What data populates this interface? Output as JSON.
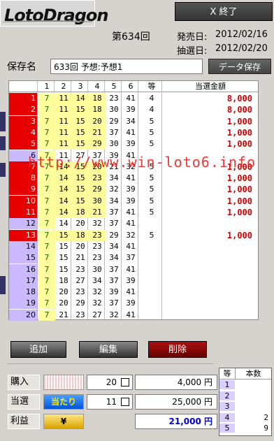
{
  "app": {
    "name": "LotoDragon",
    "logo_part1": "Loto",
    "logo_part2": "Dragon"
  },
  "header": {
    "exit_label": "X 終了",
    "draw_number": "第634回",
    "sale_label": "発売日:",
    "sale_date": "2012/02/16",
    "lottery_label": "抽選日:",
    "lottery_date": "2012/02/20"
  },
  "save": {
    "label": "保存名",
    "value": "633回 予想:予想1",
    "button": "データ保存"
  },
  "grid": {
    "headers": [
      "1",
      "2",
      "3",
      "4",
      "5",
      "6",
      "等",
      "当選金額"
    ],
    "rows": [
      {
        "n": "1",
        "nums": [
          "7",
          "11",
          "14",
          "18",
          "23",
          "41"
        ],
        "grade": "4",
        "prize": "8,000",
        "color": "red"
      },
      {
        "n": "2",
        "nums": [
          "7",
          "11",
          "15",
          "18",
          "30",
          "39"
        ],
        "grade": "4",
        "prize": "8,000",
        "color": "red"
      },
      {
        "n": "3",
        "nums": [
          "7",
          "11",
          "15",
          "20",
          "29",
          "34"
        ],
        "grade": "5",
        "prize": "1,000",
        "color": "red"
      },
      {
        "n": "4",
        "nums": [
          "7",
          "11",
          "15",
          "21",
          "37",
          "41"
        ],
        "grade": "5",
        "prize": "1,000",
        "color": "red"
      },
      {
        "n": "5",
        "nums": [
          "7",
          "11",
          "15",
          "29",
          "30",
          "39"
        ],
        "grade": "5",
        "prize": "1,000",
        "color": "red"
      },
      {
        "n": "6",
        "nums": [
          "7",
          "11",
          "27",
          "37",
          "39",
          "41"
        ],
        "grade": "",
        "prize": "",
        "color": "lav"
      },
      {
        "n": "7",
        "nums": [
          "7",
          "14",
          "15",
          "20",
          "21",
          "32"
        ],
        "grade": "5",
        "prize": "1,000",
        "color": "red"
      },
      {
        "n": "8",
        "nums": [
          "7",
          "14",
          "15",
          "23",
          "34",
          "41"
        ],
        "grade": "5",
        "prize": "1,000",
        "color": "red"
      },
      {
        "n": "9",
        "nums": [
          "7",
          "14",
          "15",
          "29",
          "32",
          "39"
        ],
        "grade": "5",
        "prize": "1,000",
        "color": "red"
      },
      {
        "n": "10",
        "nums": [
          "7",
          "14",
          "15",
          "30",
          "34",
          "39"
        ],
        "grade": "5",
        "prize": "1,000",
        "color": "red"
      },
      {
        "n": "11",
        "nums": [
          "7",
          "14",
          "18",
          "21",
          "37",
          "41"
        ],
        "grade": "5",
        "prize": "1,000",
        "color": "red"
      },
      {
        "n": "12",
        "nums": [
          "7",
          "14",
          "20",
          "32",
          "37",
          "41"
        ],
        "grade": "",
        "prize": "",
        "color": "lav"
      },
      {
        "n": "13",
        "nums": [
          "7",
          "15",
          "18",
          "23",
          "29",
          "32"
        ],
        "grade": "5",
        "prize": "1,000",
        "color": "red"
      },
      {
        "n": "14",
        "nums": [
          "7",
          "15",
          "20",
          "23",
          "34",
          "41"
        ],
        "grade": "",
        "prize": "",
        "color": "lav"
      },
      {
        "n": "15",
        "nums": [
          "7",
          "15",
          "21",
          "23",
          "34",
          "37"
        ],
        "grade": "",
        "prize": "",
        "color": "lav"
      },
      {
        "n": "16",
        "nums": [
          "7",
          "15",
          "23",
          "30",
          "37",
          "41"
        ],
        "grade": "",
        "prize": "",
        "color": "lav"
      },
      {
        "n": "17",
        "nums": [
          "7",
          "18",
          "27",
          "34",
          "37",
          "39"
        ],
        "grade": "",
        "prize": "",
        "color": "lav"
      },
      {
        "n": "18",
        "nums": [
          "7",
          "20",
          "23",
          "32",
          "39",
          "41"
        ],
        "grade": "",
        "prize": "",
        "color": "lav"
      },
      {
        "n": "19",
        "nums": [
          "7",
          "20",
          "29",
          "32",
          "37",
          "39"
        ],
        "grade": "",
        "prize": "",
        "color": "lav"
      },
      {
        "n": "20",
        "nums": [
          "7",
          "21",
          "23",
          "27",
          "32",
          "41"
        ],
        "grade": "",
        "prize": "",
        "color": "lav"
      }
    ]
  },
  "watermark": "http://www.win-loto6.info",
  "buttons": {
    "add": "追加",
    "edit": "編集",
    "delete": "削除"
  },
  "summary": {
    "purchase_label": "購入",
    "purchase_count": "20",
    "purchase_amount": "4,000 円",
    "win_label": "当選",
    "win_badge": "当たり",
    "win_count": "11",
    "win_amount": "25,000 円",
    "profit_label": "利益",
    "profit_badge": "¥",
    "profit_amount": "21,000 円"
  },
  "grade_table": {
    "header_grade": "等",
    "header_count": "本数",
    "rows": [
      {
        "g": "1",
        "c": ""
      },
      {
        "g": "2",
        "c": ""
      },
      {
        "g": "3",
        "c": ""
      },
      {
        "g": "4",
        "c": "2"
      },
      {
        "g": "5",
        "c": "9"
      }
    ]
  }
}
